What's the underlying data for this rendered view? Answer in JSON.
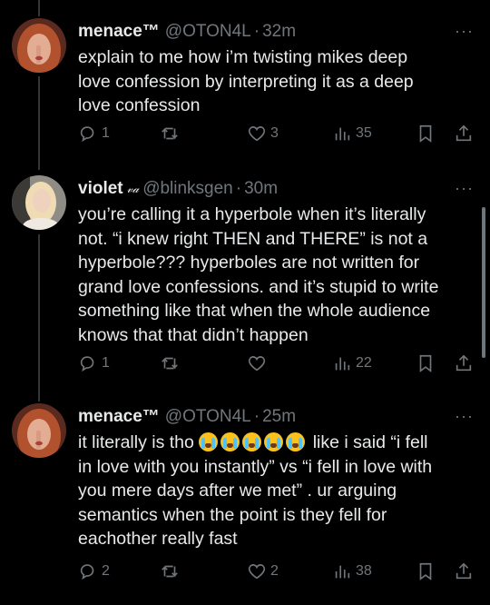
{
  "tweets": [
    {
      "name": "menace™",
      "handle": "@OTON4L",
      "time": "32m",
      "text": "explain to me how i’m twisting mikes deep\nlove confession by interpreting it as a deep\nlove confession",
      "replies": "1",
      "reposts": "",
      "likes": "3",
      "views": "35"
    },
    {
      "name": "violet",
      "name_badge": "𝓋𝒶",
      "handle": "@blinksgen",
      "time": "30m",
      "text": "you’re calling it a hyperbole when it’s literally\nnot. “i knew right THEN and THERE” is not a\nhyperbole??? hyperboles are not written for\ngrand love confessions. and it’s stupid to write\nsomething like that when the whole audience\nknows that that didn’t happen",
      "replies": "1",
      "reposts": "",
      "likes": "",
      "views": "22"
    },
    {
      "name": "menace™",
      "handle": "@OTON4L",
      "time": "25m",
      "text_pre": "it literally is tho ",
      "text_post": " like i said “i fell\nin love with you instantly” vs “i fell in love with\nyou mere days after we met” . ur arguing\nsemantics when the point is they fell for\neachother really fast",
      "replies": "2",
      "reposts": "",
      "likes": "2",
      "views": "38"
    }
  ],
  "icons": {
    "more": "···",
    "emoji": "loudly-crying-face",
    "reply": "reply-icon",
    "repost": "repost-icon",
    "like": "heart-icon",
    "views": "views-icon",
    "bookmark": "bookmark-icon",
    "share": "share-icon"
  },
  "colors": {
    "background": "#000000",
    "text": "#e7e9ea",
    "muted": "#71767b"
  }
}
